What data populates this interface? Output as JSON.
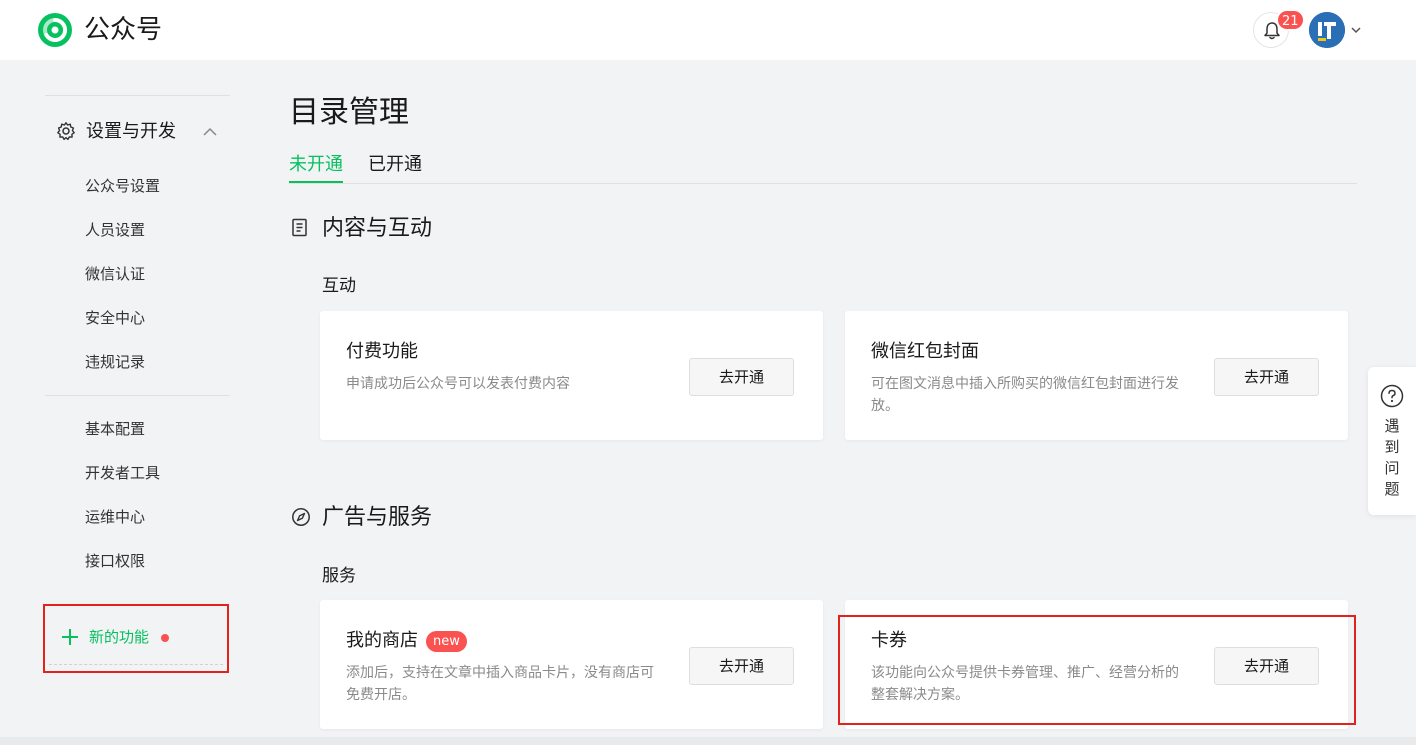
{
  "header": {
    "app_title": "公众号",
    "notification_count": "21"
  },
  "sidebar": {
    "group_label": "设置与开发",
    "items_a": [
      "公众号设置",
      "人员设置",
      "微信认证",
      "安全中心",
      "违规记录"
    ],
    "items_b": [
      "基本配置",
      "开发者工具",
      "运维中心",
      "接口权限"
    ],
    "new_features_label": "新的功能"
  },
  "main": {
    "page_title": "目录管理",
    "tabs": [
      "未开通",
      "已开通"
    ],
    "sections": [
      {
        "title": "内容与互动",
        "subtitle": "互动",
        "cards": [
          {
            "title": "付费功能",
            "desc": "申请成功后公众号可以发表付费内容",
            "button": "去开通"
          },
          {
            "title": "微信红包封面",
            "desc": "可在图文消息中插入所购买的微信红包封面进行发放。",
            "button": "去开通"
          }
        ]
      },
      {
        "title": "广告与服务",
        "subtitle": "服务",
        "cards": [
          {
            "title": "我的商店",
            "tag": "new",
            "desc": "添加后，支持在文章中插入商品卡片，没有商店可免费开店。",
            "button": "去开通"
          },
          {
            "title": "卡券",
            "desc": "该功能向公众号提供卡券管理、推广、经营分析的整套解决方案。",
            "button": "去开通"
          }
        ]
      }
    ]
  },
  "help": {
    "label": "遇到问题"
  },
  "colors": {
    "accent": "#07c160",
    "alert": "#fa5151",
    "highlight_box": "#e0231c"
  }
}
